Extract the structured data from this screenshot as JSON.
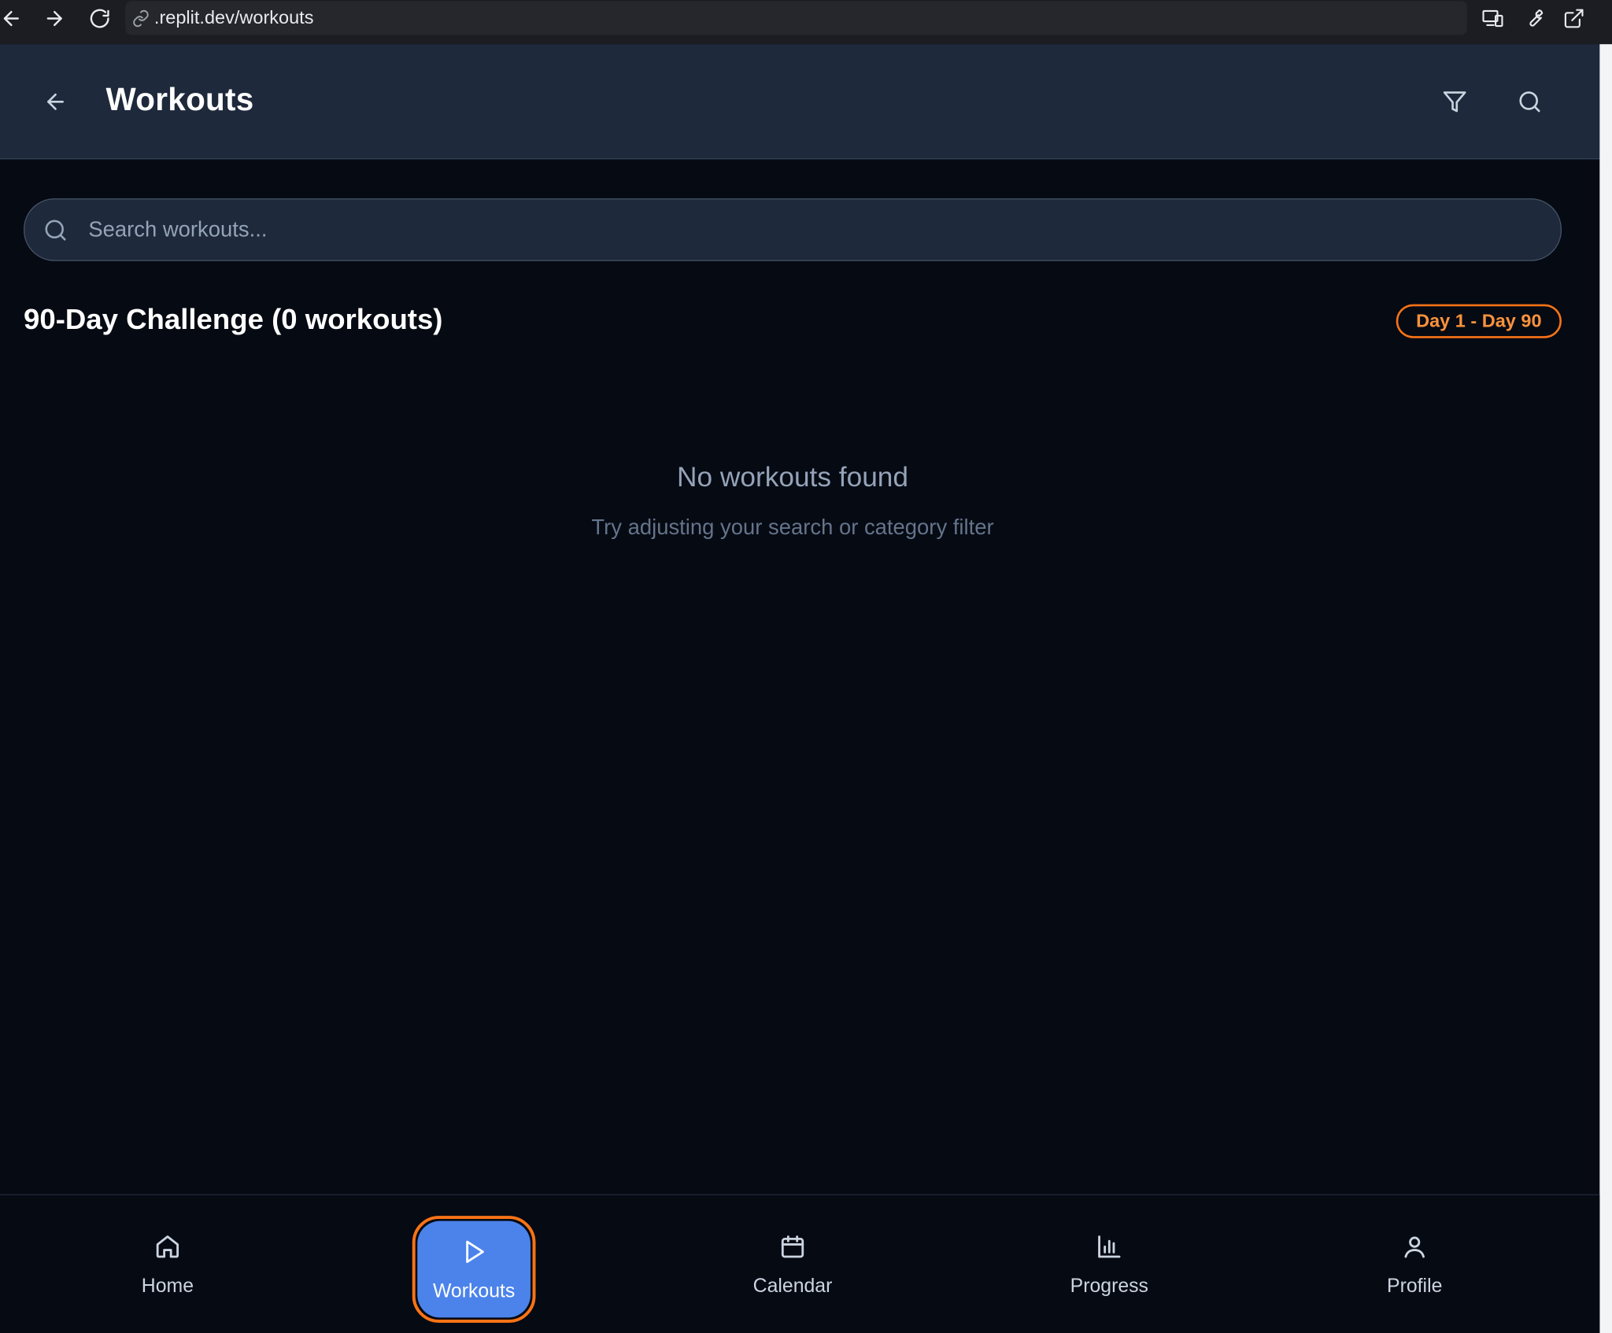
{
  "browser": {
    "url_prefix": ".replit.dev",
    "url_path": "/workouts"
  },
  "header": {
    "title": "Workouts"
  },
  "search": {
    "placeholder": "Search workouts..."
  },
  "section": {
    "title": "90-Day Challenge (0 workouts)",
    "badge": "Day 1 - Day 90"
  },
  "empty_state": {
    "title": "No workouts found",
    "subtitle": "Try adjusting your search or category filter"
  },
  "nav": {
    "items": [
      {
        "label": "Home",
        "icon": "home-icon"
      },
      {
        "label": "Workouts",
        "icon": "play-icon",
        "active": true
      },
      {
        "label": "Calendar",
        "icon": "calendar-icon"
      },
      {
        "label": "Progress",
        "icon": "bar-chart-icon"
      },
      {
        "label": "Profile",
        "icon": "user-icon"
      }
    ]
  },
  "colors": {
    "background": "#060a13",
    "header_bg": "#1e293b",
    "accent_orange": "#f97316",
    "active_blue": "#4b83ea"
  }
}
